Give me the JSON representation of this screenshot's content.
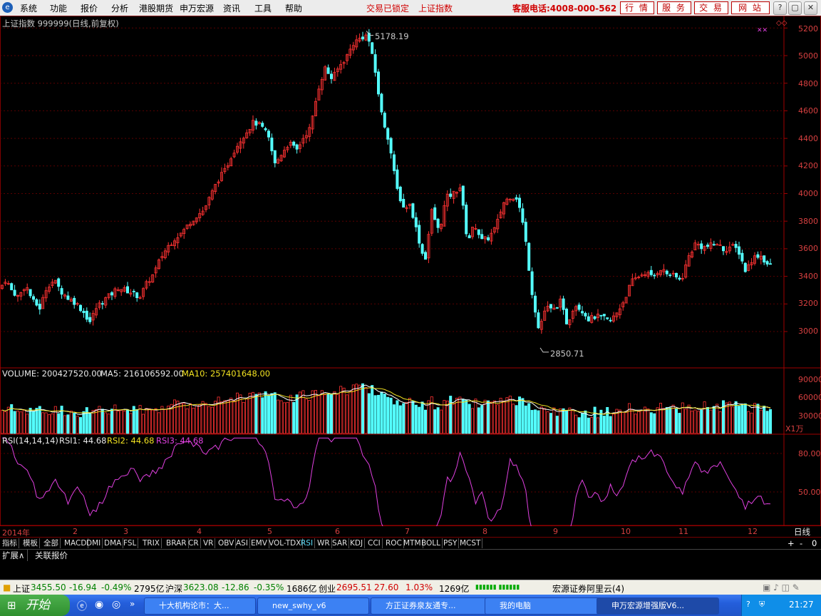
{
  "menu": {
    "items": [
      "系统",
      "功能",
      "报价",
      "分析",
      "港股期货",
      "申万宏源",
      "资讯",
      "工具",
      "帮助"
    ],
    "lock_status": "交易已锁定",
    "index_name": "上证指数",
    "hotline": "客服电话:4008-000-562",
    "buttons": [
      "行 情",
      "服 务",
      "交 易",
      "网 站"
    ]
  },
  "chart_header": {
    "title": "上证指数 999999(日线,前复权)",
    "high_label": "5178.19",
    "low_label": "2850.71"
  },
  "price_axis": [
    "5200",
    "5000",
    "4800",
    "4600",
    "4400",
    "4200",
    "4000",
    "3800",
    "3600",
    "3400",
    "3200",
    "3000"
  ],
  "volume_header": {
    "volume": "VOLUME: 200427520.00",
    "ma5": "MA5: 216106592.00",
    "ma10": "MA10: 257401648.00",
    "unit": "X1万"
  },
  "volume_axis": [
    "90000",
    "60000",
    "30000"
  ],
  "rsi_header": {
    "params": "RSI(14,14,14)",
    "rsi1": "RSI1: 44.68",
    "rsi2": "RSI2: 44.68",
    "rsi3": "RSI3: 44.68"
  },
  "rsi_axis": [
    "80.00",
    "50.00"
  ],
  "months": [
    "2014年",
    "2",
    "3",
    "4",
    "5",
    "6",
    "7",
    "8",
    "9",
    "10",
    "11",
    "12"
  ],
  "period_label": "日线",
  "zoom_controls": [
    "+",
    "-",
    "0"
  ],
  "indicator_tabs": [
    "指标",
    "模板",
    "全部",
    "MACD",
    "DMI",
    "DMA",
    "FSL",
    "TRIX",
    "BRAR",
    "CR",
    "VR",
    "OBV",
    "ASI",
    "EMV",
    "VOL-TDX",
    "RSI",
    "WR",
    "SAR",
    "KDJ",
    "CCI",
    "ROC",
    "MTM",
    "BOLL",
    "PSY",
    "MCST"
  ],
  "sub_tabs": [
    "扩展∧",
    "关联报价"
  ],
  "status": {
    "sh_label": "上证",
    "sh_value": "3455.50",
    "sh_change": "-16.94",
    "sh_pct": "-0.49%",
    "sh_amount": "2795亿",
    "hs_label": "沪深",
    "hs_value": "3623.08",
    "hs_change": "-12.86",
    "hs_pct": "-0.35%",
    "hs_amount": "1686亿",
    "cy_label": "创业",
    "cy_value": "2695.51",
    "cy_change": "27.60",
    "cy_pct": "1.03%",
    "cy_amount": "1269亿",
    "server": "宏源证券阿里云(4)"
  },
  "taskbar": {
    "start": "开始",
    "tasks": [
      "十大机构论市：大...",
      "new_swhy_v6",
      "方正证券泉友通专...",
      "我的电脑",
      "申万宏源增强版V6..."
    ],
    "clock": "21:27"
  },
  "chart_data": {
    "type": "candlestick",
    "title": "上证指数 999999(日线,前复权)",
    "period": "daily",
    "y_range": [
      2800,
      5250
    ],
    "y_ticks": [
      3000,
      3200,
      3400,
      3600,
      3800,
      4000,
      4200,
      4400,
      4600,
      4800,
      5000,
      5200
    ],
    "x_months": [
      "2014年",
      "2",
      "3",
      "4",
      "5",
      "6",
      "7",
      "8",
      "9",
      "10",
      "11",
      "12"
    ],
    "annotations": [
      {
        "label": "5178.19",
        "value": 5178.19
      },
      {
        "label": "2850.71",
        "value": 2850.71
      }
    ],
    "close_path": [
      [
        0,
        3310
      ],
      [
        8,
        3380
      ],
      [
        16,
        3300
      ],
      [
        26,
        3250
      ],
      [
        36,
        3340
      ],
      [
        46,
        3220
      ],
      [
        56,
        3170
      ],
      [
        66,
        3330
      ],
      [
        76,
        3370
      ],
      [
        86,
        3290
      ],
      [
        96,
        3240
      ],
      [
        106,
        3210
      ],
      [
        116,
        3150
      ],
      [
        126,
        3070
      ],
      [
        136,
        3180
      ],
      [
        146,
        3230
      ],
      [
        156,
        3270
      ],
      [
        166,
        3320
      ],
      [
        176,
        3300
      ],
      [
        186,
        3280
      ],
      [
        196,
        3250
      ],
      [
        206,
        3350
      ],
      [
        216,
        3420
      ],
      [
        226,
        3540
      ],
      [
        236,
        3620
      ],
      [
        246,
        3680
      ],
      [
        256,
        3720
      ],
      [
        266,
        3790
      ],
      [
        276,
        3840
      ],
      [
        286,
        3880
      ],
      [
        296,
        3990
      ],
      [
        306,
        4100
      ],
      [
        316,
        4170
      ],
      [
        326,
        4290
      ],
      [
        336,
        4380
      ],
      [
        346,
        4450
      ],
      [
        356,
        4520
      ],
      [
        366,
        4490
      ],
      [
        376,
        4420
      ],
      [
        386,
        4210
      ],
      [
        396,
        4300
      ],
      [
        406,
        4370
      ],
      [
        416,
        4310
      ],
      [
        426,
        4410
      ],
      [
        436,
        4480
      ],
      [
        446,
        4750
      ],
      [
        456,
        4910
      ],
      [
        466,
        4830
      ],
      [
        476,
        4920
      ],
      [
        486,
        4990
      ],
      [
        496,
        5090
      ],
      [
        506,
        5130
      ],
      [
        516,
        5150
      ],
      [
        526,
        4900
      ],
      [
        536,
        4560
      ],
      [
        546,
        4380
      ],
      [
        556,
        4050
      ],
      [
        566,
        3900
      ],
      [
        576,
        3920
      ],
      [
        586,
        3700
      ],
      [
        596,
        3500
      ],
      [
        606,
        3880
      ],
      [
        616,
        3720
      ],
      [
        626,
        3970
      ],
      [
        636,
        4000
      ],
      [
        646,
        4050
      ],
      [
        656,
        3650
      ],
      [
        666,
        3780
      ],
      [
        676,
        3660
      ],
      [
        686,
        3680
      ],
      [
        696,
        3760
      ],
      [
        706,
        3930
      ],
      [
        716,
        3980
      ],
      [
        726,
        3970
      ],
      [
        736,
        3720
      ],
      [
        746,
        3300
      ],
      [
        756,
        3010
      ],
      [
        766,
        3180
      ],
      [
        776,
        3150
      ],
      [
        786,
        3220
      ],
      [
        796,
        3050
      ],
      [
        806,
        3200
      ],
      [
        816,
        3160
      ],
      [
        826,
        3090
      ],
      [
        836,
        3110
      ],
      [
        846,
        3100
      ],
      [
        856,
        3070
      ],
      [
        866,
        3140
      ],
      [
        876,
        3230
      ],
      [
        886,
        3360
      ],
      [
        896,
        3400
      ],
      [
        906,
        3430
      ],
      [
        916,
        3390
      ],
      [
        926,
        3460
      ],
      [
        936,
        3420
      ],
      [
        946,
        3400
      ],
      [
        956,
        3370
      ],
      [
        966,
        3540
      ],
      [
        976,
        3640
      ],
      [
        986,
        3610
      ],
      [
        996,
        3620
      ],
      [
        1006,
        3640
      ],
      [
        1016,
        3590
      ],
      [
        1026,
        3620
      ],
      [
        1036,
        3590
      ],
      [
        1046,
        3440
      ],
      [
        1056,
        3530
      ],
      [
        1066,
        3560
      ],
      [
        1076,
        3490
      ],
      [
        1084,
        3470
      ]
    ]
  }
}
